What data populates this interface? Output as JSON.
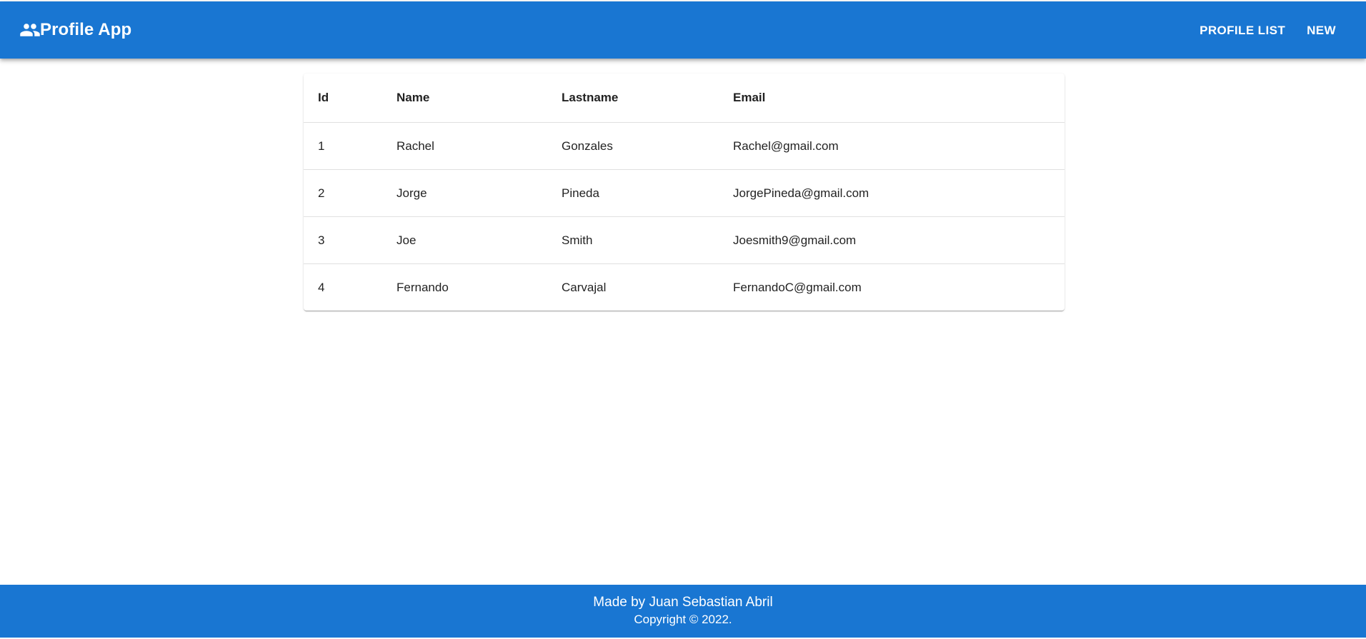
{
  "colors": {
    "primary": "#1976d2",
    "text": "#212121",
    "divider": "#e0e0e0"
  },
  "header": {
    "icon": "people-icon",
    "title": "Profile App",
    "nav": [
      {
        "label": "PROFILE LIST"
      },
      {
        "label": "NEW"
      }
    ]
  },
  "table": {
    "columns": [
      "Id",
      "Name",
      "Lastname",
      "Email"
    ],
    "rows": [
      {
        "id": "1",
        "name": "Rachel",
        "lastname": "Gonzales",
        "email": "Rachel@gmail.com"
      },
      {
        "id": "2",
        "name": "Jorge",
        "lastname": "Pineda",
        "email": "JorgePineda@gmail.com"
      },
      {
        "id": "3",
        "name": "Joe",
        "lastname": "Smith",
        "email": "Joesmith9@gmail.com"
      },
      {
        "id": "4",
        "name": "Fernando",
        "lastname": "Carvajal",
        "email": "FernandoC@gmail.com"
      }
    ]
  },
  "footer": {
    "credit": "Made by Juan Sebastian Abril",
    "copyright": "Copyright © 2022."
  }
}
